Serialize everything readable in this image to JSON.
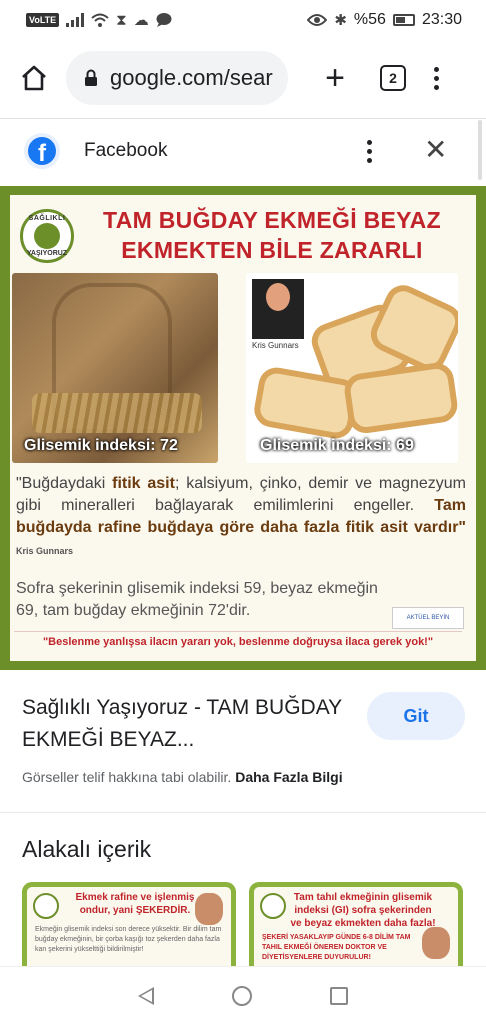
{
  "status_bar": {
    "volte": "VoLTE",
    "battery_percent": "%56",
    "time": "23:30",
    "icons": [
      "signal-icon",
      "wifi-icon",
      "hourglass-icon",
      "cloud-icon",
      "chat-icon",
      "eye-icon",
      "bluetooth-icon",
      "battery-icon"
    ]
  },
  "browser": {
    "url": "google.com/sear",
    "tab_count": "2",
    "icons": [
      "home-icon",
      "lock-icon",
      "plus-icon",
      "tabs-icon",
      "more-vert-icon"
    ]
  },
  "panel": {
    "source_title": "Facebook",
    "icons": [
      "facebook-logo-icon",
      "more-vert-icon",
      "close-icon"
    ]
  },
  "hero_image": {
    "logo_text_top": "SAĞLIKLI",
    "logo_text_bottom": "YAŞIYORUZ",
    "headline_line1": "TAM BUĞDAY EKMEĞİ BEYAZ",
    "headline_line2": "EKMEKTEN BİLE ZARARLI",
    "person_caption": "Kris Gunnars",
    "gi_left": "Glisemik indeksi: 72",
    "gi_right": "Glisemik indeksi: 69",
    "quote_part1": "\"Buğdaydaki ",
    "quote_bold1": "fitik asit",
    "quote_part2": "; kalsiyum, çinko, demir ve magnezyum gibi mineralleri bağlayarak emilimlerini engeller. ",
    "quote_bold2": "Tam buğdayda rafine buğdaya göre daha fazla fitik asit vardır\"",
    "quote_author": "Kris Gunnars",
    "sugar_text": "Sofra şekerinin glisemik indeksi 59, beyaz ekmeğin 69, tam buğday ekmeğinin 72'dir.",
    "small_logo_text": "AKTÜEL BEYİN",
    "bottom_quote": "\"Beslenme yanlışsa ilacın yararı yok, beslenme doğruysa ilaca gerek yok!\""
  },
  "result": {
    "title": "Sağlıklı Yaşıyoruz - TAM BUĞDAY EKMEĞİ BEYAZ...",
    "visit_label": "Git",
    "copyright_text": "Görseller telif hakkına tabi olabilir. ",
    "more_info": "Daha Fazla Bilgi"
  },
  "related": {
    "title": "Alakalı içerik",
    "items": [
      {
        "heading": "Ekmek rafine ve işlenmiş ondur, yani ŞEKERDİR.",
        "body": "Ekmeğin glisemik indeksi son derece yüksektir. Bir dilim tam buğday ekmeğinin, bir çorba kaşığı toz şekerden daha fazla kan şekerini yükselttiği bildirilmiştir!"
      },
      {
        "heading": "Tam tahıl ekmeğinin glisemik indeksi (GI) sofra şekerinden ve beyaz ekmekten daha fazla!",
        "body": "ŞEKERİ YASAKLAYIP GÜNDE 6-8 DİLİM TAM TAHIL EKMEĞİ ÖNEREN DOKTOR VE DİYETİSYENLERE DUYURULUR!"
      }
    ]
  },
  "nav_bar": {
    "icons": [
      "back-icon",
      "home-circle-icon",
      "recent-apps-icon"
    ]
  }
}
